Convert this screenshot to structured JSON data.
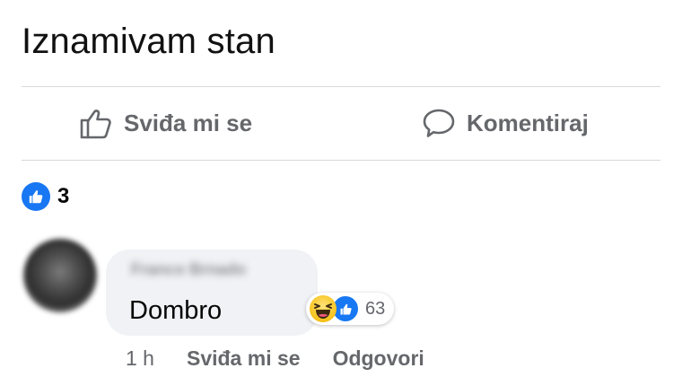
{
  "post": {
    "text": "Iznamivam stan"
  },
  "actions": {
    "like_label": "Sviđa mi se",
    "comment_label": "Komentiraj"
  },
  "reactions_summary": {
    "icon": "like-reaction-icon",
    "count": "3"
  },
  "comment": {
    "author": "Franco Brnado",
    "text": "Dombro",
    "reactions": {
      "icons": [
        "haha-reaction-icon",
        "like-reaction-icon"
      ],
      "count": "63"
    },
    "meta": {
      "time": "1 h",
      "like_label": "Sviđa mi se",
      "reply_label": "Odgovori"
    }
  },
  "colors": {
    "facebook_blue": "#1877f2",
    "muted_text": "#65676b",
    "bubble_bg": "#f0f2f5",
    "divider": "#d7d9dc"
  }
}
